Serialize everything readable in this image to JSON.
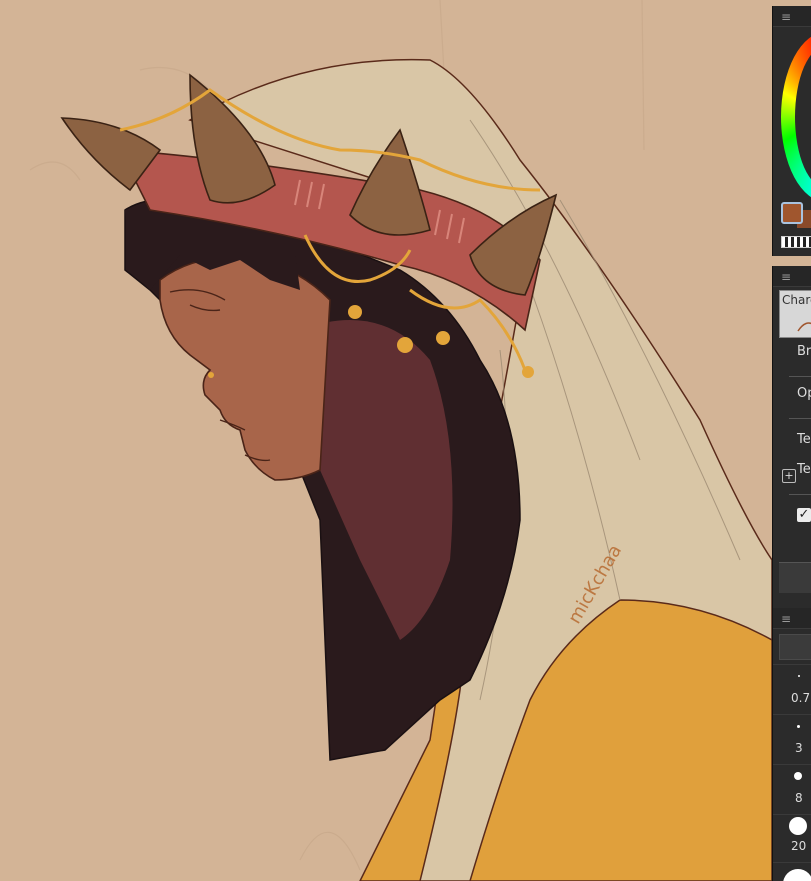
{
  "canvas": {
    "artwork": "digital-painting",
    "signature": "micKchaa",
    "colors": {
      "background": "#d3b496",
      "veil": "#d9c6a6",
      "hair": "#2a1a1c",
      "skin": "#a8654a",
      "headband": "#b4564e",
      "horn": "#8c6242",
      "garment": "#e0a03c",
      "gold": "#e3a53a"
    }
  },
  "color_panel": {
    "main_color": "#a0562e",
    "sub_color": "#8a4a2a"
  },
  "tool_property": {
    "tool_name": "Charcoal",
    "labels": [
      "Br",
      "Op",
      "Te",
      "Te"
    ],
    "checkbox_checked": true
  },
  "brush_size": {
    "items": [
      "0.7",
      "3",
      "8",
      "20"
    ]
  }
}
